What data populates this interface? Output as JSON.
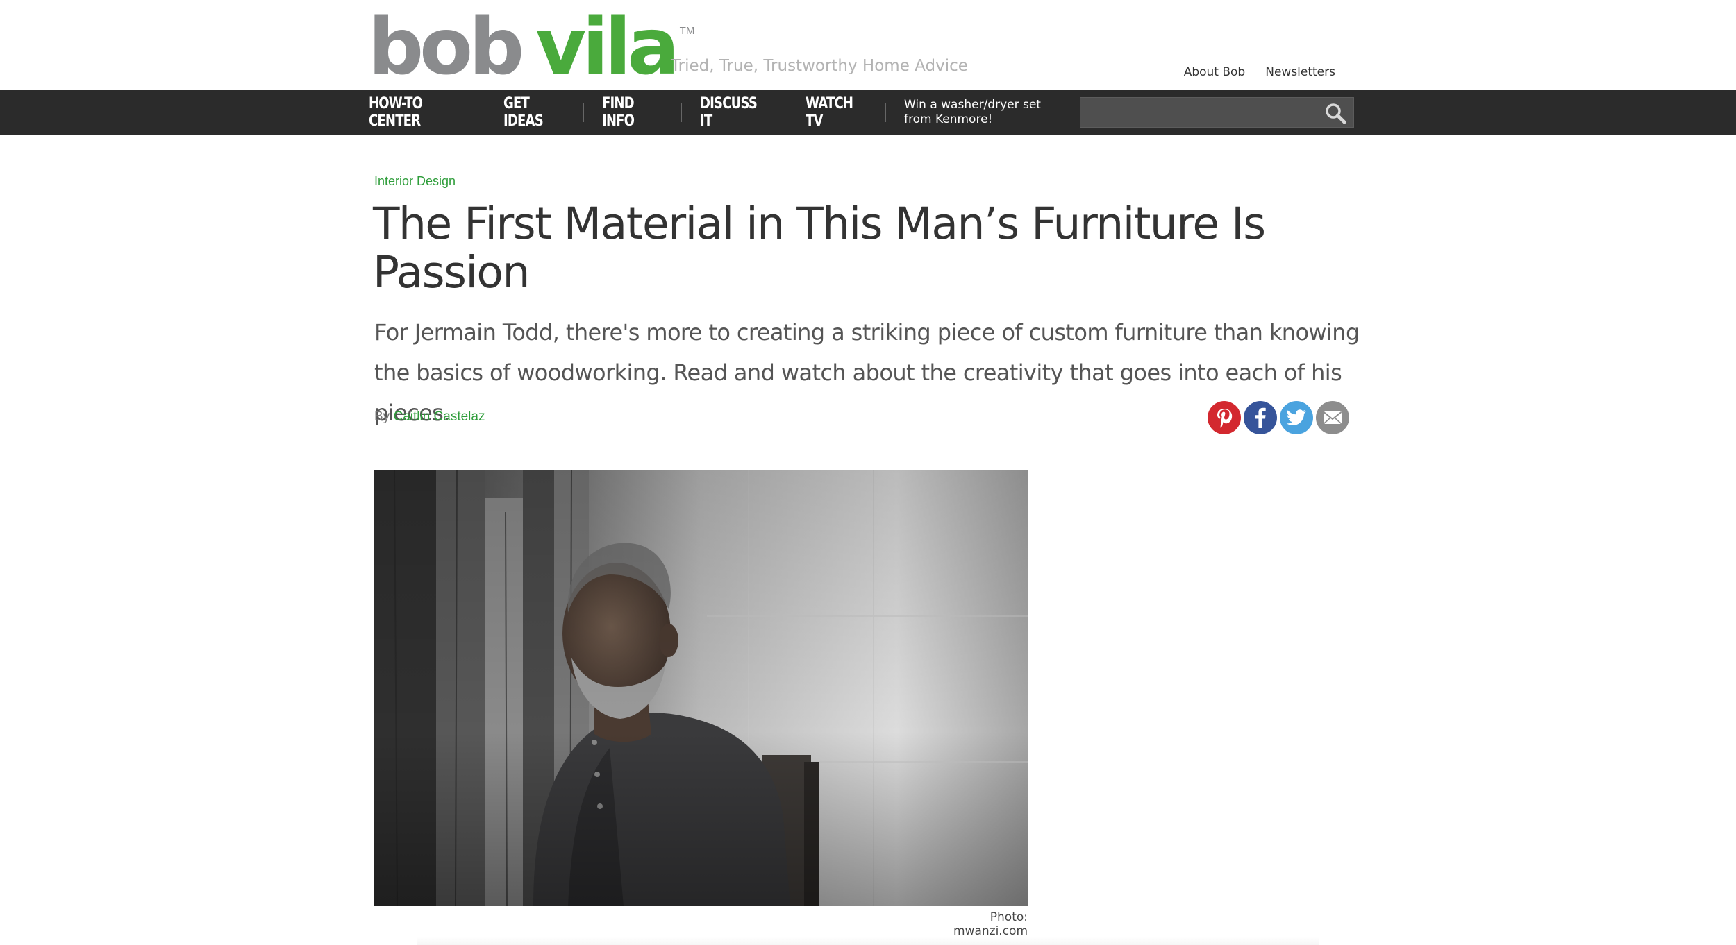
{
  "header": {
    "logo": {
      "word1": "bob",
      "word2": "vila",
      "trademark": "TM"
    },
    "tagline": "Tried, True, Trustworthy Home Advice",
    "utility_links": [
      "About Bob",
      "Newsletters"
    ]
  },
  "nav": {
    "items": [
      "HOW-TO CENTER",
      "GET IDEAS",
      "FIND INFO",
      "DISCUSS IT",
      "WATCH TV"
    ],
    "promo": "Win a washer/dryer set from Kenmore!",
    "search": {
      "value": "",
      "placeholder": "",
      "icon": "search-icon"
    }
  },
  "article": {
    "category": "Interior Design",
    "headline": "The First Material in This Man’s Furniture Is Passion",
    "dek": "For Jermain Todd, there's more to creating a striking piece of custom furniture than knowing the basics of woodworking. Read and watch about the creativity that goes into each of his pieces.",
    "byline_prefix": "By",
    "author": "Caitlin Castelaz",
    "share_icons": [
      "pinterest-icon",
      "facebook-icon",
      "twitter-icon",
      "email-icon"
    ],
    "photo_credit": "Photo: mwanzi.com"
  },
  "colors": {
    "brand_green": "#4aaa3c",
    "brand_gray": "#8a8b8d",
    "nav_bg": "#2b2b2b",
    "link_green": "#2e9d3a",
    "pinterest": "#d3282f",
    "facebook": "#36549a",
    "twitter": "#4aa3df",
    "email": "#8d8d8d"
  }
}
